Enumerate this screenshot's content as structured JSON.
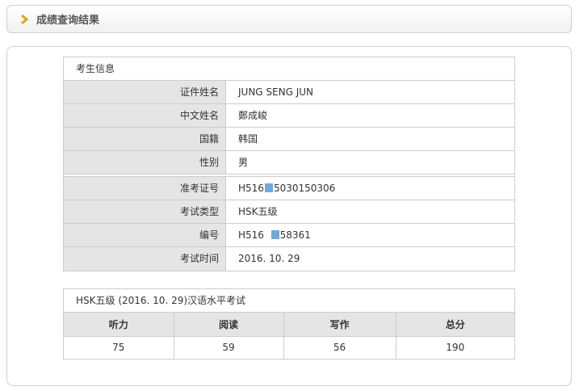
{
  "header": {
    "title": "成绩查询结果",
    "icon": "chevron-right-icon",
    "accent_color": "#e8a317"
  },
  "candidate": {
    "section_title": "考生信息",
    "rows": [
      {
        "label": "证件姓名",
        "value": "JUNG SENG JUN"
      },
      {
        "label": "中文姓名",
        "value": "鄭成峻"
      },
      {
        "label": "国籍",
        "value": "韩国"
      },
      {
        "label": "性别",
        "value": "男"
      }
    ]
  },
  "exam": {
    "rows": [
      {
        "label": "准考证号",
        "value_prefix": "H516",
        "value_suffix": "5030150306"
      },
      {
        "label": "考试类型",
        "value": "HSK五级"
      },
      {
        "label": "编号",
        "value_prefix": "H516",
        "value_suffix": "58361"
      },
      {
        "label": "考试时间",
        "value": "2016. 10. 29"
      }
    ]
  },
  "scores": {
    "title": "HSK五级 (2016. 10. 29)汉语水平考试",
    "columns": [
      "听力",
      "阅读",
      "写作",
      "总分"
    ],
    "values": [
      "75",
      "59",
      "56",
      "190"
    ]
  },
  "colors": {
    "label_bg": "#e5e5e5",
    "border": "#cccccc",
    "redaction": "#6fa8dc"
  }
}
